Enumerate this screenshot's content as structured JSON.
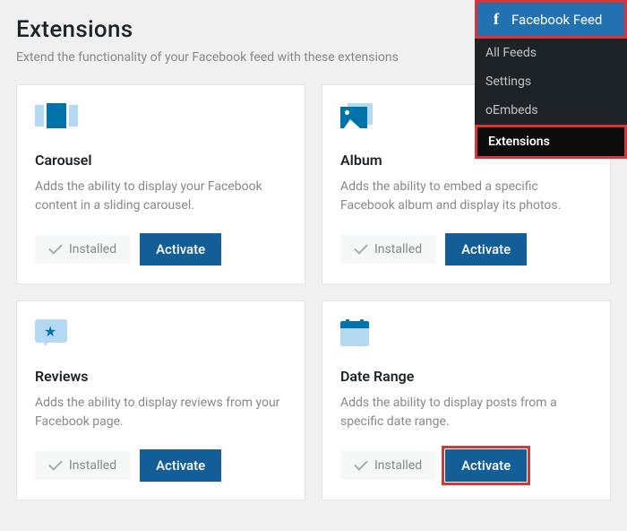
{
  "sidebar": {
    "header": "Facebook Feed",
    "items": [
      {
        "label": "All Feeds",
        "active": false
      },
      {
        "label": "Settings",
        "active": false
      },
      {
        "label": "oEmbeds",
        "active": false
      },
      {
        "label": "Extensions",
        "active": true
      }
    ]
  },
  "page": {
    "title": "Extensions",
    "subtitle": "Extend the functionality of your Facebook feed with these extensions"
  },
  "cards": {
    "carousel": {
      "title": "Carousel",
      "desc": "Adds the ability to display your Facebook content in a sliding carousel.",
      "installed_label": "Installed",
      "activate_label": "Activate"
    },
    "album": {
      "title": "Album",
      "desc": "Adds the ability to embed a specific Facebook album and display its photos.",
      "installed_label": "Installed",
      "activate_label": "Activate"
    },
    "reviews": {
      "title": "Reviews",
      "desc": "Adds the ability to display reviews from your Facebook page.",
      "installed_label": "Installed",
      "activate_label": "Activate"
    },
    "date_range": {
      "title": "Date Range",
      "desc": "Adds the ability to display posts from a specific date range.",
      "installed_label": "Installed",
      "activate_label": "Activate"
    }
  }
}
